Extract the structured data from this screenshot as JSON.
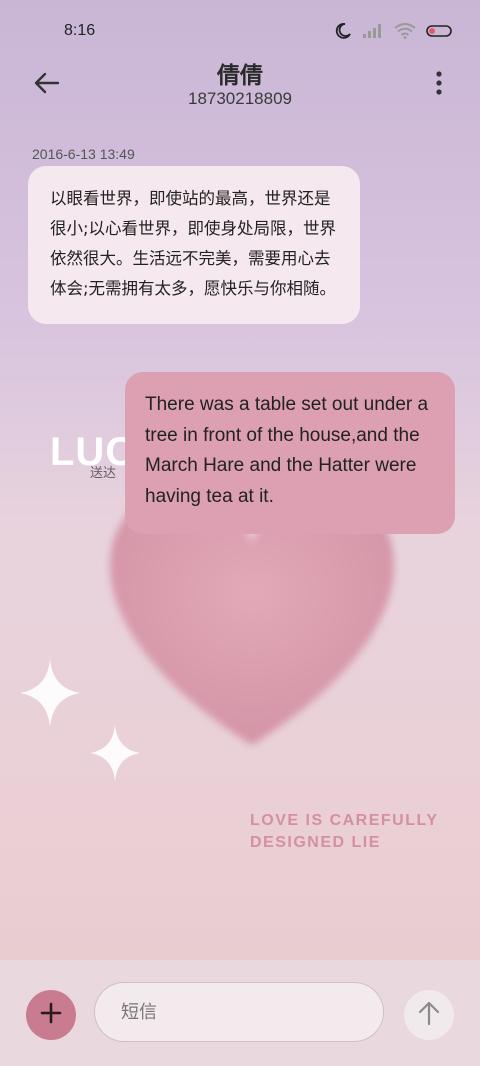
{
  "status_bar": {
    "time": "8:16",
    "icons": [
      "moon-icon",
      "signal-icon",
      "wifi-icon",
      "battery-icon"
    ]
  },
  "header": {
    "contact_name": "倩倩",
    "contact_number": "18730218809",
    "back_icon": "back-arrow-icon",
    "more_icon": "more-vertical-icon"
  },
  "conversation": {
    "timestamp": "2016-6-13 13:49",
    "messages": [
      {
        "direction": "incoming",
        "text": "以眼看世界，即使站的最高，世界还是很小;以心看世界，即使身处局限，世界依然很大。生活远不完美，需要用心去体会;无需拥有太多，愿快乐与你相随。"
      },
      {
        "direction": "outgoing",
        "text": "There was a table set out under a tree in front of the house,and the March Hare and the Hatter were having tea at it."
      }
    ]
  },
  "wallpaper": {
    "lucky_text": "LUC",
    "delivered_text": "送达",
    "tagline_line1": "LOVE IS CAREFULLY",
    "tagline_line2": "DESIGNED LIE",
    "heart_color": "#dca0b2"
  },
  "composer": {
    "add_icon": "plus-icon",
    "placeholder": "短信",
    "send_icon": "send-arrow-icon"
  },
  "colors": {
    "outgoing_bubble": "#dca0b2",
    "incoming_bubble": "#f5e8ee",
    "accent": "#c97b8f"
  }
}
